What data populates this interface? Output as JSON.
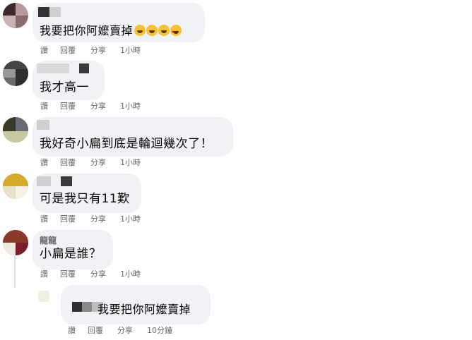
{
  "comments": [
    {
      "text": "我要把你阿嬤賣掉",
      "emojis": [
        "rolling-laugh-emoji",
        "rolling-laugh-emoji",
        "rolling-laugh-emoji",
        "star-struck-emoji"
      ],
      "actions": {
        "like": "讚",
        "reply": "回覆",
        "share": "分享",
        "time": "1小時"
      }
    },
    {
      "text": "我才高一",
      "actions": {
        "like": "讚",
        "reply": "回覆",
        "share": "分享",
        "time": "1小時"
      }
    },
    {
      "text": "我好奇小扁到底是輪迴幾次了！",
      "actions": {
        "like": "讚",
        "reply": "回覆",
        "share": "分享",
        "time": "1小時"
      }
    },
    {
      "text": "可是我只有11歎",
      "actions": {
        "like": "讚",
        "reply": "回覆",
        "share": "分享",
        "time": "1小時"
      }
    },
    {
      "name": "龍龍",
      "text": "小扁是誰？",
      "actions": {
        "like": "讚",
        "reply": "回覆",
        "share": "分享",
        "time": "1小時"
      }
    }
  ],
  "reply": {
    "text": "我要把你阿嬤賣掉",
    "actions": {
      "like": "讚",
      "reply": "回覆",
      "share": "分享",
      "time": "10分鐘"
    }
  },
  "colors": {
    "bubble": "#f0f2f5",
    "meta": "#65676b",
    "text": "#050505"
  }
}
